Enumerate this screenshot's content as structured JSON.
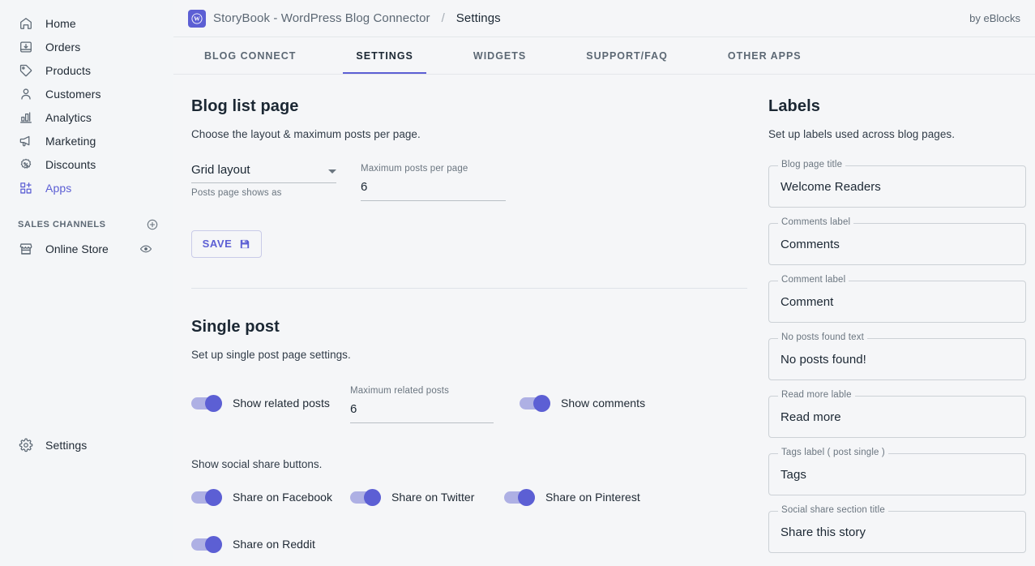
{
  "sidebar": {
    "items": [
      {
        "label": "Home",
        "icon": "home-icon",
        "active": false
      },
      {
        "label": "Orders",
        "icon": "orders-icon",
        "active": false
      },
      {
        "label": "Products",
        "icon": "products-tag-icon",
        "active": false
      },
      {
        "label": "Customers",
        "icon": "customers-icon",
        "active": false
      },
      {
        "label": "Analytics",
        "icon": "analytics-bars-icon",
        "active": false
      },
      {
        "label": "Marketing",
        "icon": "marketing-megaphone-icon",
        "active": false
      },
      {
        "label": "Discounts",
        "icon": "discounts-percent-icon",
        "active": false
      },
      {
        "label": "Apps",
        "icon": "apps-grid-plus-icon",
        "active": true
      }
    ],
    "sales_channels": {
      "heading": "SALES CHANNELS",
      "add_icon": "plus-circle-icon",
      "channels": [
        {
          "label": "Online Store",
          "icon": "store-icon",
          "action_icon": "eye-icon"
        }
      ]
    },
    "settings": {
      "label": "Settings",
      "icon": "gear-icon"
    },
    "accent_color": "#5c5fd4"
  },
  "header": {
    "logo_icon": "wordpress-logo-icon",
    "app_name": "StoryBook - WordPress Blog Connector",
    "separator": "/",
    "current_page": "Settings",
    "byline": "by eBlocks"
  },
  "tabs": [
    {
      "label": "BLOG CONNECT",
      "active": false
    },
    {
      "label": "SETTINGS",
      "active": true
    },
    {
      "label": "WIDGETS",
      "active": false
    },
    {
      "label": "SUPPORT/FAQ",
      "active": false
    },
    {
      "label": "OTHER APPS",
      "active": false
    }
  ],
  "blog_list_page": {
    "title": "Blog list page",
    "subtitle": "Choose the layout & maximum posts per page.",
    "layout_select": {
      "label": "",
      "value": "Grid layout",
      "helper": "Posts page shows as",
      "caret_icon": "chevron-down-icon"
    },
    "max_posts": {
      "label": "Maximum posts per page",
      "value": "6"
    },
    "save_button": {
      "label": "SAVE",
      "icon": "save-floppy-icon"
    }
  },
  "single_post": {
    "title": "Single post",
    "subtitle": "Set up single post page settings.",
    "show_related_posts": {
      "label": "Show related posts",
      "on": true
    },
    "max_related_posts": {
      "label": "Maximum related posts",
      "value": "6"
    },
    "show_comments": {
      "label": "Show comments",
      "on": true
    },
    "social_note": "Show social share buttons.",
    "social_toggles": [
      {
        "label": "Share on Facebook",
        "on": true
      },
      {
        "label": "Share on Twitter",
        "on": true
      },
      {
        "label": "Share on Pinterest",
        "on": true
      },
      {
        "label": "Share on Reddit",
        "on": true
      }
    ]
  },
  "labels_panel": {
    "title": "Labels",
    "subtitle": "Set up labels used across blog pages.",
    "fields": [
      {
        "label": "Blog page title",
        "value": "Welcome Readers"
      },
      {
        "label": "Comments label",
        "value": "Comments"
      },
      {
        "label": "Comment label",
        "value": "Comment"
      },
      {
        "label": "No posts found text",
        "value": "No posts found!"
      },
      {
        "label": "Read more lable",
        "value": "Read more"
      },
      {
        "label": "Tags label ( post single )",
        "value": "Tags"
      },
      {
        "label": "Social share section title",
        "value": "Share this story"
      }
    ]
  }
}
